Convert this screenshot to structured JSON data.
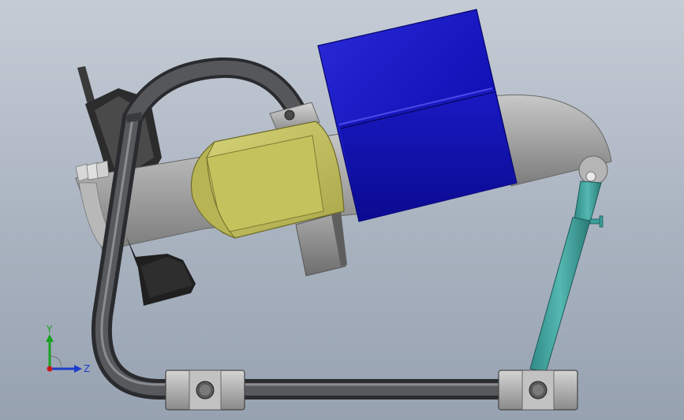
{
  "triad": {
    "y_label": "Y",
    "z_label": "Z",
    "colors": {
      "y_axis": "#18a020",
      "z_axis": "#1c3ccc",
      "origin": "#c81818"
    }
  },
  "model_colors": {
    "motor_housing": "#1212b8",
    "gear_housing": "#c2c060",
    "frame_tube": "#4a4c50",
    "strut_rod": "#3a9e9a",
    "metal": "#9a9c9e",
    "handle": "#2a2a2a"
  }
}
